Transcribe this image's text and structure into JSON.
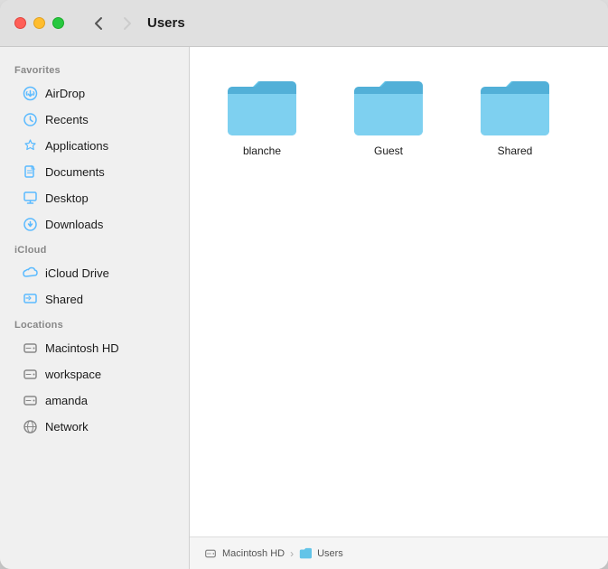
{
  "window": {
    "title": "Users"
  },
  "traffic_lights": {
    "close": "close",
    "minimize": "minimize",
    "maximize": "maximize"
  },
  "nav": {
    "back_label": "‹",
    "forward_label": "›",
    "back_disabled": false,
    "forward_disabled": false
  },
  "sidebar": {
    "sections": [
      {
        "id": "favorites",
        "label": "Favorites",
        "items": [
          {
            "id": "airdrop",
            "label": "AirDrop",
            "icon": "airdrop"
          },
          {
            "id": "recents",
            "label": "Recents",
            "icon": "recents"
          },
          {
            "id": "applications",
            "label": "Applications",
            "icon": "applications"
          },
          {
            "id": "documents",
            "label": "Documents",
            "icon": "documents"
          },
          {
            "id": "desktop",
            "label": "Desktop",
            "icon": "desktop"
          },
          {
            "id": "downloads",
            "label": "Downloads",
            "icon": "downloads"
          }
        ]
      },
      {
        "id": "icloud",
        "label": "iCloud",
        "items": [
          {
            "id": "icloud-drive",
            "label": "iCloud Drive",
            "icon": "icloud"
          },
          {
            "id": "shared-icloud",
            "label": "Shared",
            "icon": "shared"
          }
        ]
      },
      {
        "id": "locations",
        "label": "Locations",
        "items": [
          {
            "id": "macintosh-hd",
            "label": "Macintosh HD",
            "icon": "disk"
          },
          {
            "id": "workspace",
            "label": "workspace",
            "icon": "disk"
          },
          {
            "id": "amanda",
            "label": "amanda",
            "icon": "disk"
          },
          {
            "id": "network",
            "label": "Network",
            "icon": "network"
          }
        ]
      }
    ]
  },
  "folders": [
    {
      "id": "blanche",
      "label": "blanche"
    },
    {
      "id": "guest",
      "label": "Guest"
    },
    {
      "id": "shared",
      "label": "Shared"
    }
  ],
  "statusbar": {
    "drive_label": "Macintosh HD",
    "separator": "›",
    "folder_label": "Users"
  }
}
